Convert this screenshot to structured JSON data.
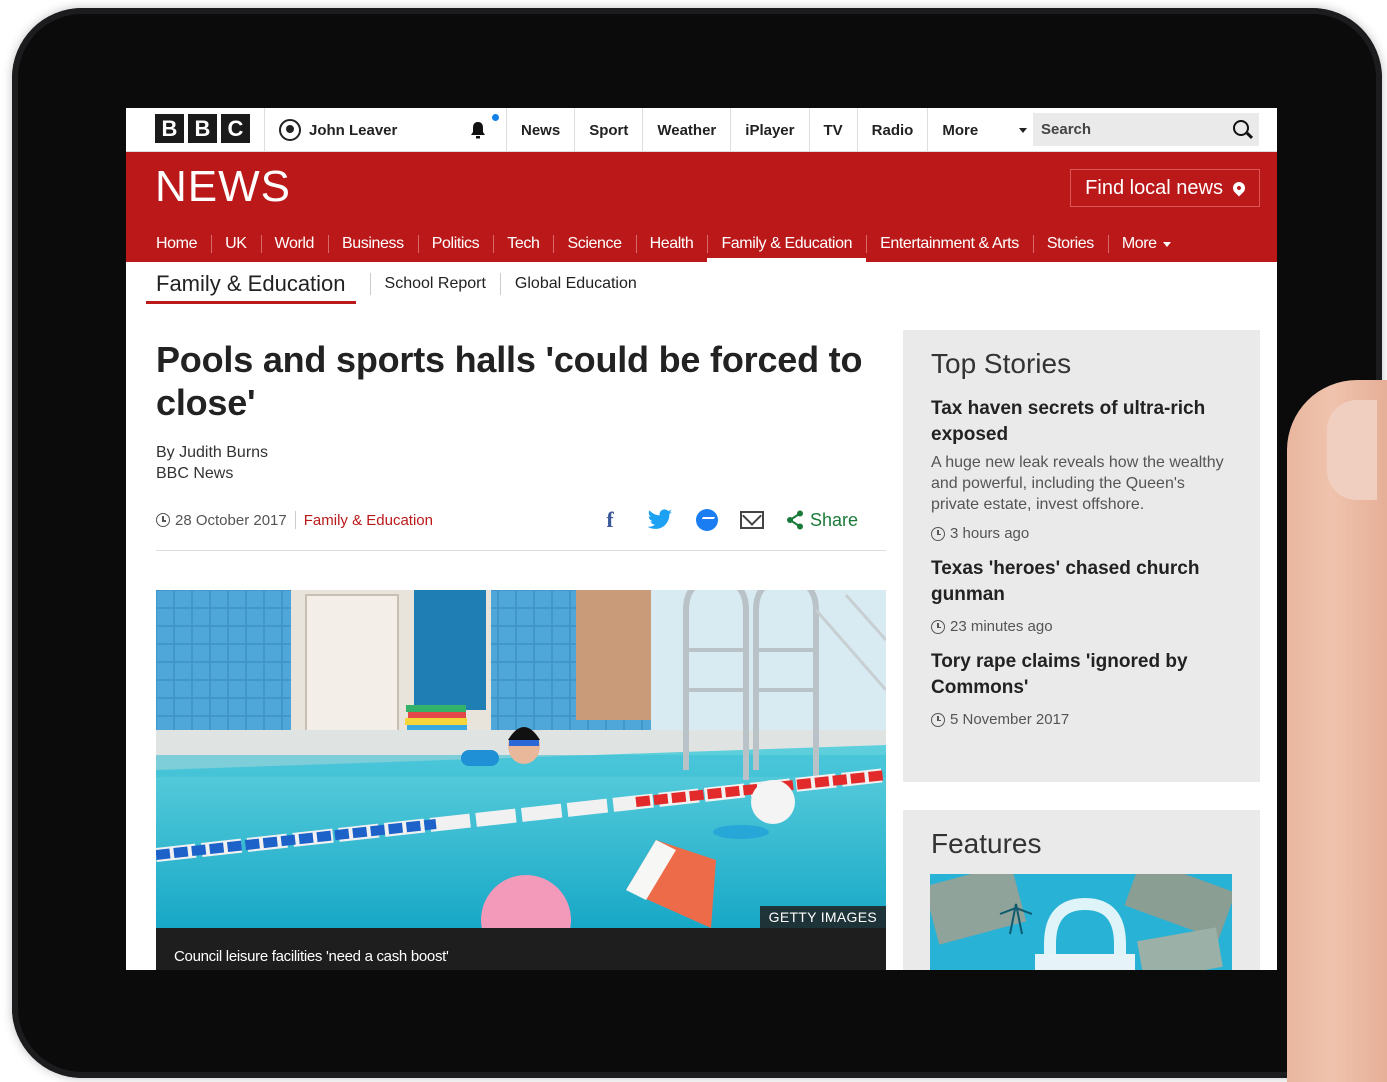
{
  "topbar": {
    "logo_letters": [
      "B",
      "B",
      "C"
    ],
    "account_name": "John Leaver",
    "nav": [
      "News",
      "Sport",
      "Weather",
      "iPlayer",
      "TV",
      "Radio"
    ],
    "more_label": "More",
    "search_placeholder": "Search"
  },
  "newsband": {
    "logo": "NEWS",
    "local_button": "Find local news",
    "nav": [
      "Home",
      "UK",
      "World",
      "Business",
      "Politics",
      "Tech",
      "Science",
      "Health",
      "Family & Education",
      "Entertainment & Arts",
      "Stories"
    ],
    "active_index": 8,
    "more_label": "More"
  },
  "subnav": {
    "current": "Family & Education",
    "links": [
      "School Report",
      "Global Education"
    ]
  },
  "article": {
    "headline": "Pools and sports halls 'could be forced to close'",
    "author": "By Judith Burns",
    "outlet": "BBC News",
    "date": "28 October 2017",
    "category": "Family & Education",
    "share_label": "Share",
    "image_credit": "GETTY IMAGES",
    "caption": "Council leisure facilities 'need a cash boost'"
  },
  "sidebar": {
    "top_stories_title": "Top Stories",
    "stories": [
      {
        "title": "Tax haven secrets of ultra-rich exposed",
        "summary": "A huge new leak reveals how the wealthy and powerful, including the Queen's private estate, invest offshore.",
        "time": "3 hours ago"
      },
      {
        "title": "Texas 'heroes' chased church gunman",
        "summary": "",
        "time": "23 minutes ago"
      },
      {
        "title": "Tory rape claims 'ignored by Commons'",
        "summary": "",
        "time": "5 November 2017"
      }
    ],
    "features_title": "Features"
  },
  "colors": {
    "bbc_red": "#bb1919",
    "share_green": "#1a7a38",
    "facebook_blue": "#3b5998",
    "twitter_blue": "#1da1f2",
    "messenger_blue": "#1a7ef2"
  }
}
